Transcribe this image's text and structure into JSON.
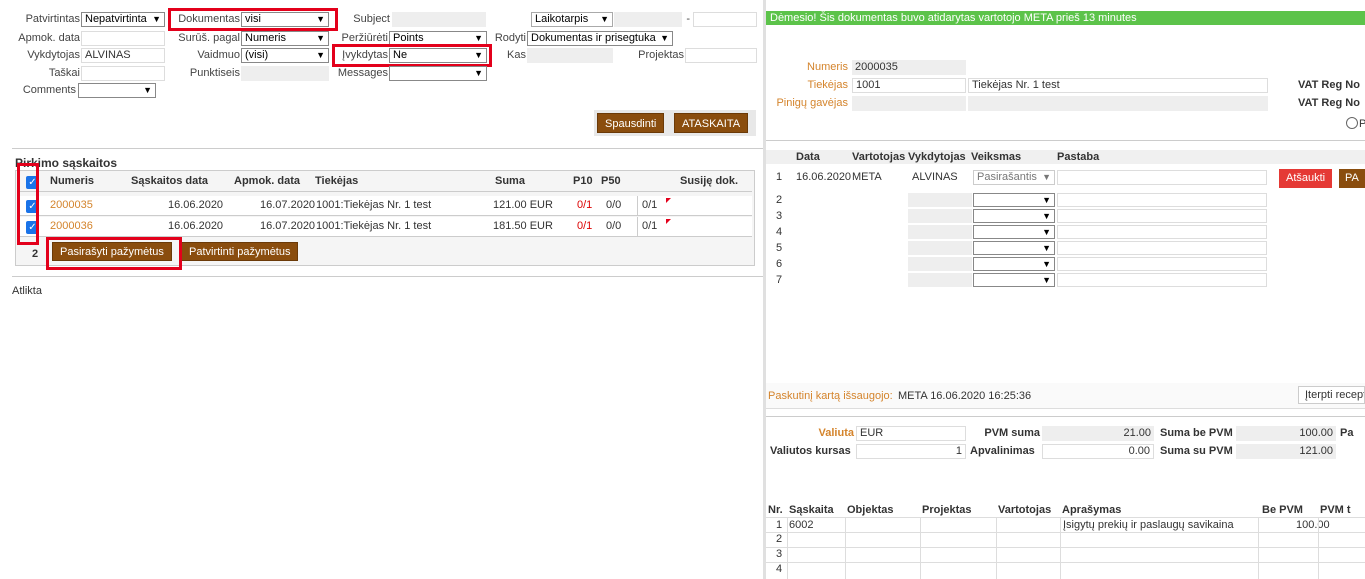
{
  "filters": {
    "patvirtintas_label": "Patvirtintas",
    "patvirtintas_value": "Nepatvirtinta",
    "dokumentas_label": "Dokumentas",
    "dokumentas_value": "visi",
    "subject_label": "Subject",
    "laikotarpis_value": "Laikotarpis",
    "dash": "-",
    "apmok_label": "Apmok. data",
    "surus_label": "Surūš. pagal",
    "surus_value": "Numeris",
    "perziureti_label": "Peržiūrėti",
    "perziureti_value": "Points",
    "rodyti_label": "Rodyti",
    "rodyti_value": "Dokumentas ir prisegtuka",
    "vykdytojas_label": "Vykdytojas",
    "vykdytojas_value": "ALVINAS",
    "vaidmuo_label": "Vaidmuo",
    "vaidmuo_value": "(visi)",
    "ivykdytas_label": "Įvykdytas",
    "ivykdytas_value": "Ne",
    "kas_label": "Kas",
    "projektas_label": "Projektas",
    "taskai_label": "Taškai",
    "punktiseis_label": "Punktiseis",
    "messages_label": "Messages",
    "comments_label": "Comments"
  },
  "actions": {
    "spausdinti": "Spausdinti",
    "ataskaita": "ATASKAITA"
  },
  "list": {
    "title": "Pirkimo sąskaitos",
    "headers": [
      "Numeris",
      "Sąskaitos data",
      "Apmok. data",
      "Tiekėjas",
      "Suma",
      "P10",
      "P50",
      "Susiję dok."
    ],
    "rows": [
      {
        "numeris": "2000035",
        "saskaitos_data": "16.06.2020",
        "apmok_data": "16.07.2020",
        "tiekejas": "1001:Tiekėjas Nr. 1 test",
        "suma": "121.00 EUR",
        "p10": "0/1",
        "p50": "0/0",
        "extra": "0/1"
      },
      {
        "numeris": "2000036",
        "saskaitos_data": "16.06.2020",
        "apmok_data": "16.07.2020",
        "tiekejas": "1001:Tiekėjas Nr. 1 test",
        "suma": "181.50 EUR",
        "p10": "0/1",
        "p50": "0/0",
        "extra": "0/1"
      }
    ],
    "count": "2",
    "pasirasyti_button": "Pasirašyti pažymėtus",
    "patvirtinti_button": "Patvirtinti pažymėtus",
    "status": "Atlikta"
  },
  "doc": {
    "warning": "Dėmesio! Šis dokumentas buvo atidarytas vartotojo META prieš 13 minutes",
    "numeris_label": "Numeris",
    "numeris_value": "2000035",
    "tiekejas_label": "Tiekėjas",
    "tiekejas_code": "1001",
    "tiekejas_name": "Tiekėjas Nr. 1 test",
    "vatreg_label": "VAT Reg No",
    "piniguo_label": "Pinigų gavėjas",
    "vatreg2_label": "VAT Reg No",
    "radio_partial": "P"
  },
  "workflow": {
    "headers": [
      "Data",
      "Vartotojas",
      "Vykdytojas",
      "Veiksmas",
      "Pastaba"
    ],
    "row1": {
      "nr": "1",
      "data": "16.06.2020",
      "vartotojas": "META",
      "vykdytojas": "ALVINAS",
      "veiksmas": "Pasirašantis"
    },
    "row_numbers": [
      "2",
      "3",
      "4",
      "5",
      "6",
      "7"
    ],
    "atsaukti": "Atšaukti",
    "pa": "PA"
  },
  "footer": {
    "paskutini_label": "Paskutinį kartą išsaugojo:",
    "paskutini_value": "META 16.06.2020 16:25:36",
    "iterpti": "Įterpti recepta"
  },
  "totals": {
    "valiuta_label": "Valiuta",
    "valiuta_value": "EUR",
    "pvm_suma_label": "PVM suma",
    "pvm_suma_value": "21.00",
    "suma_be_pvm_label": "Suma be PVM",
    "suma_be_pvm_value": "100.00",
    "pa_label": "Pa",
    "kursas_label": "Valiutos kursas",
    "kursas_value": "1",
    "apvalinimas_label": "Apvalinimas",
    "apvalinimas_value": "0.00",
    "suma_su_pvm_label": "Suma su PVM",
    "suma_su_pvm_value": "121.00"
  },
  "lines": {
    "headers": [
      "Nr.",
      "Sąskaita",
      "Objektas",
      "Projektas",
      "Vartotojas",
      "Aprašymas",
      "Be PVM",
      "PVM t"
    ],
    "row1": {
      "nr": "1",
      "saskaita": "6002",
      "aprasymas": "Įsigytų prekių ir paslaugų savikaina",
      "be_pvm": "100.00"
    },
    "row_numbers": [
      "2",
      "3",
      "4"
    ]
  }
}
